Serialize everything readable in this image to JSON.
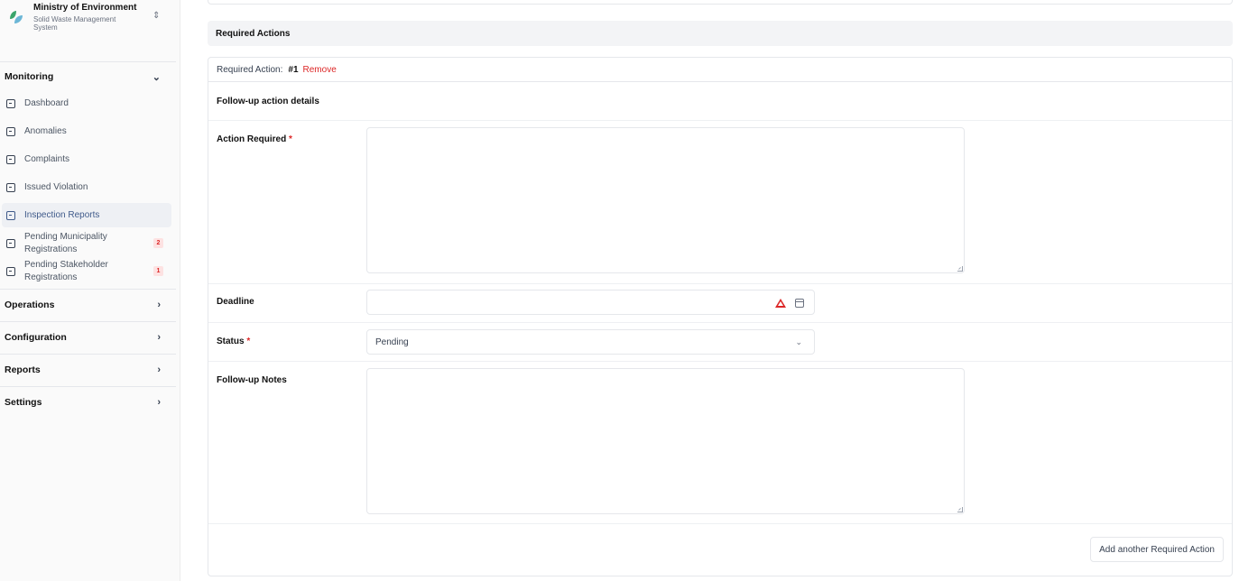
{
  "brand": {
    "title": "Ministry of Environment",
    "subtitle": "Solid Waste Management System",
    "logo_colors": [
      "#3aa56b",
      "#6bb6d6"
    ]
  },
  "sidebar": {
    "monitoring": {
      "label": "Monitoring",
      "items": [
        {
          "label": "Dashboard"
        },
        {
          "label": "Anomalies"
        },
        {
          "label": "Complaints"
        },
        {
          "label": "Issued Violation"
        },
        {
          "label": "Inspection Reports",
          "active": true
        },
        {
          "label": "Pending Municipality Registrations",
          "badge": "2"
        },
        {
          "label": "Pending Stakeholder Registrations",
          "badge": "1"
        }
      ]
    },
    "groups": [
      {
        "label": "Operations"
      },
      {
        "label": "Configuration"
      },
      {
        "label": "Reports"
      },
      {
        "label": "Settings"
      }
    ]
  },
  "main": {
    "section_title": "Required Actions",
    "card": {
      "header_label": "Required Action:",
      "header_number": "#1",
      "remove_label": "Remove",
      "subheading": "Follow-up action details",
      "fields": {
        "action_required": {
          "label": "Action Required",
          "required": "*",
          "value": ""
        },
        "deadline": {
          "label": "Deadline",
          "value": ""
        },
        "status": {
          "label": "Status",
          "required": "*",
          "value": "Pending"
        },
        "followup_notes": {
          "label": "Follow-up Notes",
          "value": ""
        }
      },
      "add_button_label": "Add another Required Action"
    }
  },
  "colors": {
    "accent": "#3f5a8a",
    "danger": "#dc2626",
    "border": "#e5e7eb"
  }
}
